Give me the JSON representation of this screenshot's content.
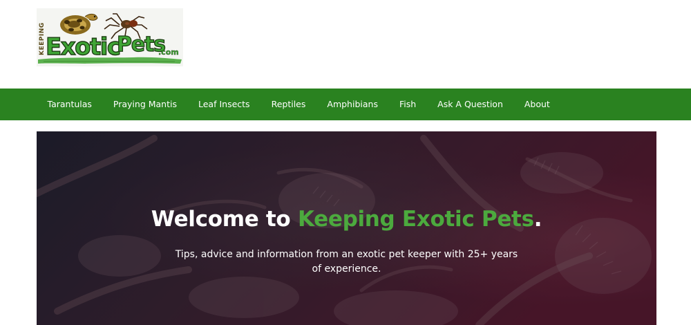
{
  "logo": {
    "word_keeping": "KEEPING",
    "word_exotic": "Exotic",
    "word_pets": "Pets",
    "word_com": ".com",
    "colors": {
      "green_text": "#3fa535",
      "outline": "#1b3d12",
      "brush": "#4aa83c"
    }
  },
  "nav": {
    "items": [
      "Tarantulas",
      "Praying Mantis",
      "Leaf Insects",
      "Reptiles",
      "Amphibians",
      "Fish",
      "Ask A Question",
      "About"
    ],
    "background_color": "#2a8220"
  },
  "hero": {
    "title_prefix": "Welcome to ",
    "title_highlight": "Keeping Exotic Pets",
    "title_suffix": ".",
    "subtitle": "Tips, advice and information from an exotic pet keeper with 25+ years of experience.",
    "highlight_color": "#4caa3e"
  }
}
